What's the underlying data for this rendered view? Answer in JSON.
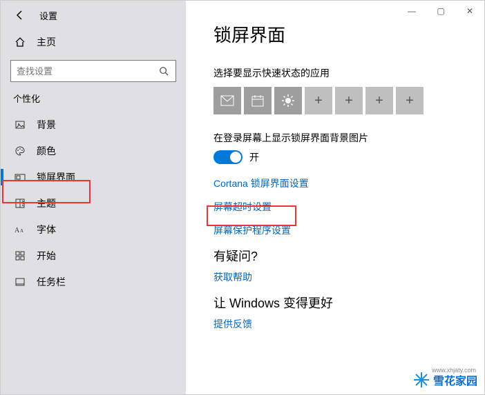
{
  "window": {
    "title": "设置",
    "controls": {
      "min": "—",
      "max": "▢",
      "close": "✕"
    }
  },
  "sidebar": {
    "home_label": "主页",
    "search_placeholder": "查找设置",
    "section_header": "个性化",
    "items": [
      {
        "icon": "image",
        "label": "背景"
      },
      {
        "icon": "palette",
        "label": "颜色"
      },
      {
        "icon": "lock",
        "label": "锁屏界面",
        "selected": true
      },
      {
        "icon": "theme",
        "label": "主题"
      },
      {
        "icon": "font",
        "label": "字体"
      },
      {
        "icon": "start",
        "label": "开始"
      },
      {
        "icon": "taskbar",
        "label": "任务栏"
      }
    ]
  },
  "content": {
    "page_title": "锁屏界面",
    "quick_status_label": "选择要显示快速状态的应用",
    "tiles": [
      "mail",
      "calendar",
      "weather",
      "add",
      "add",
      "add",
      "add"
    ],
    "bg_toggle_label": "在登录屏幕上显示锁屏界面背景图片",
    "bg_toggle_state": "开",
    "links": {
      "cortana": "Cortana 锁屏界面设置",
      "timeout": "屏幕超时设置",
      "screensaver": "屏幕保护程序设置"
    },
    "help_heading": "有疑问?",
    "help_link": "获取帮助",
    "improve_heading": "让 Windows 变得更好",
    "feedback_link": "提供反馈"
  },
  "watermark": {
    "brand": "雪花家园",
    "url": "www.xhjaty.com"
  }
}
